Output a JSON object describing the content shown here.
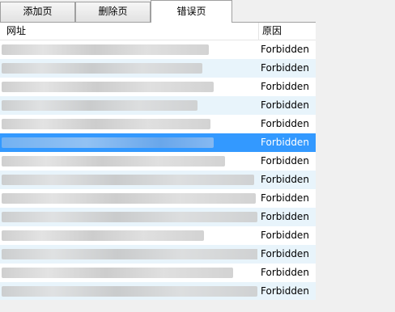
{
  "tabs": [
    {
      "label": "添加页",
      "active": false
    },
    {
      "label": "删除页",
      "active": false
    },
    {
      "label": "错误页",
      "active": true
    }
  ],
  "table": {
    "columns": [
      "网址",
      "原因"
    ],
    "rows": [
      {
        "reason": "Forbidden"
      },
      {
        "reason": "Forbidden"
      },
      {
        "reason": "Forbidden"
      },
      {
        "reason": "Forbidden"
      },
      {
        "reason": "Forbidden"
      },
      {
        "reason": "Forbidden"
      },
      {
        "reason": "Forbidden"
      },
      {
        "reason": "Forbidden"
      },
      {
        "reason": "Forbidden"
      },
      {
        "reason": "Forbidden"
      },
      {
        "reason": "Forbidden"
      },
      {
        "reason": "Forbidden"
      },
      {
        "reason": "Forbidden"
      },
      {
        "reason": "Forbidden"
      }
    ],
    "selected_row": 5
  },
  "status": {
    "text": ""
  },
  "colors": {
    "selection": "#3399ff",
    "alt_row": "#e8f4fb"
  }
}
